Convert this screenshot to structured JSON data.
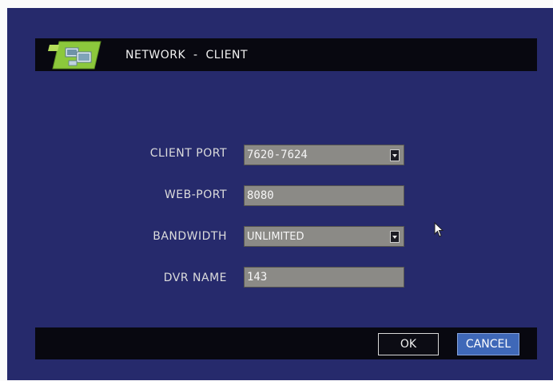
{
  "window": {
    "title": "NETWORK  -  CLIENT",
    "background_color": "#262a6c",
    "bar_color": "#080810"
  },
  "title_icon": "network-monitor-icon",
  "form": {
    "client_port": {
      "label": "CLIENT PORT",
      "value": "7620-7624",
      "type": "dropdown"
    },
    "web_port": {
      "label": "WEB-PORT",
      "value": "8080",
      "type": "text"
    },
    "bandwidth": {
      "label": "BANDWIDTH",
      "value": "UNLIMITED",
      "type": "dropdown"
    },
    "dvr_name": {
      "label": "DVR  NAME",
      "value": "143",
      "type": "text"
    }
  },
  "buttons": {
    "ok": "OK",
    "cancel": "CANCEL",
    "cancel_color": "#3f68b8"
  },
  "cursor_icon": "mouse-pointer-icon"
}
